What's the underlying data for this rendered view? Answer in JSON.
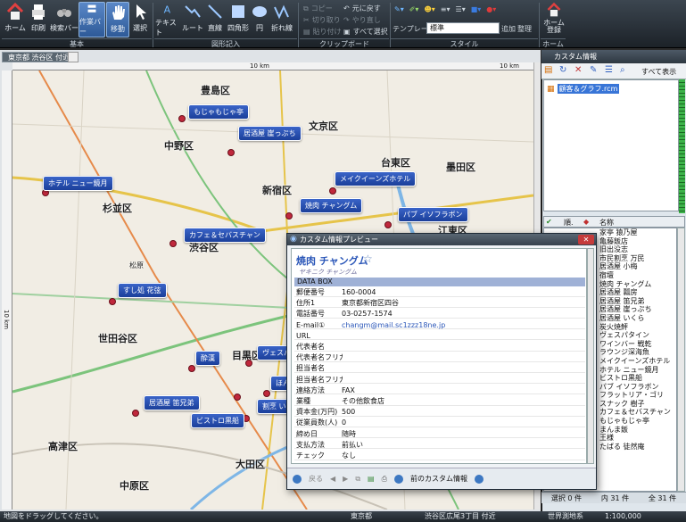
{
  "ribbon": {
    "basic": {
      "home": "ホーム",
      "print": "印刷",
      "search_bar": "検索バー",
      "work_bar": "作業バー",
      "move": "移動",
      "select": "選択",
      "group": "基本"
    },
    "draw": {
      "text": "テキスト",
      "route": "ルート",
      "line": "直線",
      "rect": "四角形",
      "circle": "円",
      "polyline": "折れ線",
      "group": "図形記入"
    },
    "clipboard": {
      "copy": "コピー",
      "cut": "切り取り",
      "paste": "貼り付け",
      "undo": "元に戻す",
      "redo": "やり直し",
      "select_all": "すべて選択",
      "group": "クリップボード"
    },
    "style": {
      "template_label": "テンプレート",
      "template_value": "標準",
      "add": "追加",
      "organize": "整理",
      "group": "スタイル"
    },
    "home_group": {
      "home_register": "ホーム\n登録",
      "group": "ホーム"
    }
  },
  "map": {
    "tab": "東京都 渋谷区 付近",
    "ruler_top_1": "10 km",
    "ruler_top_2": "10 km",
    "ruler_left": "10 km",
    "wards": [
      "豊島区",
      "中野区",
      "文京区",
      "台東区",
      "墨田区",
      "新宿区",
      "杉並区",
      "渋谷区",
      "江東区",
      "世田谷区",
      "目黒区",
      "高津区",
      "大田区",
      "中原区",
      "松原"
    ],
    "pins": [
      "もじゃもじゃ亭",
      "居酒屋 崖っぷち",
      "メイクイーンズホテル",
      "ホテル ニュー鏡月",
      "焼肉 チャングム",
      "パブ イソフラボン",
      "カフェ＆セバスチャン",
      "すし処 花弦",
      "酔漢",
      "居酒屋 笛兄弟",
      "ビストロ黒船",
      "ほん",
      "ヴェスパタ",
      "割烹 い"
    ]
  },
  "right_panel": {
    "title": "カスタム情報",
    "show_all": "すべて表示",
    "tree_item": "顧客＆グラフ.rcm",
    "col_order": "順.",
    "col_name": "名称",
    "items": [
      "家亭 猿乃屋",
      "亀藤飯店",
      "旧出没志",
      "市民割烹 万民",
      "居酒屋 小梅",
      "宿壇",
      "焼肉 チャングム",
      "居酒屋 瓢房",
      "居酒屋 笛兄弟",
      "居酒屋 崖っぷち",
      "居酒屋 いくら",
      "炭火焼鮃",
      "ヴェスパタイン",
      "ワインバー 戦乾",
      "ラウンジ深海魚",
      "メイクイーンズホテル",
      "ホテル ニュー鏡月",
      "ビストロ黒船",
      "パブ イソフラボン",
      "フラットリア・ゴリ",
      "スナック 樹子",
      "カフェ＆セバスチャン",
      "もじゃもじゃ亭",
      "まんま飯",
      "王様",
      "たばる 徒然庵"
    ],
    "footer_selected": "選択 0 件",
    "footer_count": "内 31 件",
    "footer_total": "全 31 件"
  },
  "popup": {
    "title": "カスタム情報プレビュー",
    "name": "焼肉 チャングム",
    "kana": "ヤキニク チャングム",
    "section": "DATA BOX",
    "rows": [
      [
        "郵便番号",
        "160-0004"
      ],
      [
        "住所1",
        "東京都新宿区四谷"
      ],
      [
        "電話番号",
        "03-0257-1574"
      ],
      [
        "E-mail①",
        "changm@mail.sc1zzz18ne.jp"
      ],
      [
        "URL",
        ""
      ],
      [
        "代表者名",
        ""
      ],
      [
        "代表者名フリガナ",
        ""
      ],
      [
        "担当者名",
        ""
      ],
      [
        "担当者名フリガナ",
        ""
      ],
      [
        "連絡方法",
        "FAX"
      ],
      [
        "業種",
        "その他飲食店"
      ],
      [
        "資本金(万円)",
        "500"
      ],
      [
        "従業員数(人)",
        "0"
      ],
      [
        "締め日",
        "随時"
      ],
      [
        "支払方法",
        "前払い"
      ],
      [
        "チェック",
        "なし"
      ]
    ],
    "footer_return": "戻る",
    "footer_prev": "前のカスタム情報"
  },
  "status": {
    "hint": "地図をドラッグしてください。",
    "pref": "東京都",
    "address": "渋谷区広尾3丁目 付近",
    "datum": "世界測地系",
    "scale": "1:100,000"
  }
}
